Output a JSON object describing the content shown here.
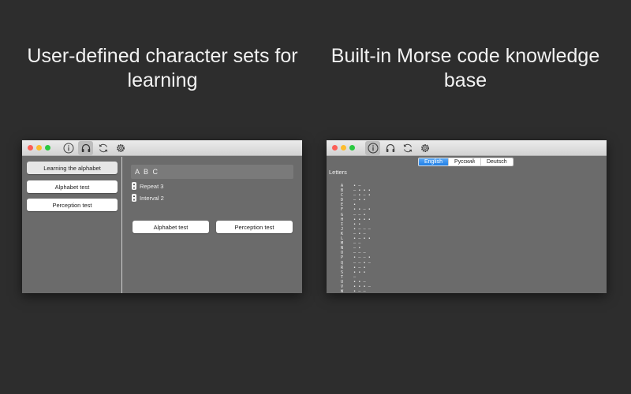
{
  "captions": {
    "left": "User-defined character sets for learning",
    "right": "Built-in Morse code knowledge base"
  },
  "left_window": {
    "sidebar": {
      "items": [
        {
          "label": "Learning the alphabet",
          "selected": true
        },
        {
          "label": "Alphabet test",
          "selected": false
        },
        {
          "label": "Perception test",
          "selected": false
        }
      ]
    },
    "pane": {
      "charset_value": "A B C",
      "repeat_label": "Repeat 3",
      "interval_label": "Interval 2",
      "alphabet_test_label": "Alphabet test",
      "perception_test_label": "Perception test"
    }
  },
  "right_window": {
    "languages": [
      "English",
      "Русский",
      "Deutsch"
    ],
    "selected_language": "English",
    "section_title": "Letters",
    "letters": [
      {
        "letter": "A",
        "code": "• —"
      },
      {
        "letter": "B",
        "code": "— • • •"
      },
      {
        "letter": "C",
        "code": "— • — •"
      },
      {
        "letter": "D",
        "code": "— • •"
      },
      {
        "letter": "E",
        "code": "•"
      },
      {
        "letter": "F",
        "code": "• • — •"
      },
      {
        "letter": "G",
        "code": "— — •"
      },
      {
        "letter": "H",
        "code": "• • • •"
      },
      {
        "letter": "I",
        "code": "• •"
      },
      {
        "letter": "J",
        "code": "• — — —"
      },
      {
        "letter": "K",
        "code": "— • —"
      },
      {
        "letter": "L",
        "code": "• — • •"
      },
      {
        "letter": "M",
        "code": "— —"
      },
      {
        "letter": "N",
        "code": "— •"
      },
      {
        "letter": "O",
        "code": "— — —"
      },
      {
        "letter": "P",
        "code": "• — — •"
      },
      {
        "letter": "Q",
        "code": "— — • —"
      },
      {
        "letter": "R",
        "code": "• — •"
      },
      {
        "letter": "S",
        "code": "• • •"
      },
      {
        "letter": "T",
        "code": "—"
      },
      {
        "letter": "U",
        "code": "• • —"
      },
      {
        "letter": "V",
        "code": "• • • —"
      },
      {
        "letter": "W",
        "code": "• — —"
      }
    ]
  },
  "toolbar_icons": [
    "info-icon",
    "headphones-icon",
    "sync-icon",
    "gear-icon"
  ],
  "colors": {
    "background": "#2d2d2d",
    "window_body": "#6b6b6b",
    "accent": "#1f7fe6"
  }
}
